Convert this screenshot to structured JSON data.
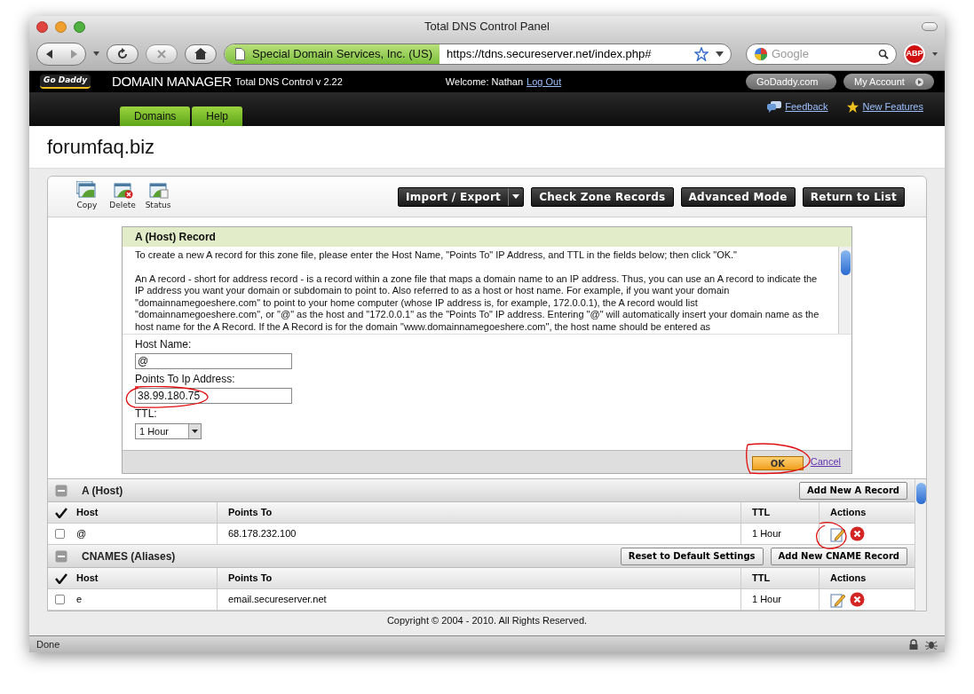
{
  "window": {
    "title": "Total DNS Control Panel"
  },
  "toolbar": {
    "site_identity": "Special Domain Services, Inc. (US)",
    "url": "https://tdns.secureserver.net/index.php#",
    "search_placeholder": "Google",
    "adblock_label": "ABP"
  },
  "header": {
    "logo_text": "Go Daddy",
    "app_name": "DOMAIN MANAGER",
    "version": "Total DNS Control v 2.22",
    "welcome": "Welcome: Nathan",
    "logout": "Log Out",
    "buttons": [
      "GoDaddy.com",
      "My Account"
    ]
  },
  "nav": {
    "tabs": [
      {
        "label": "Domains"
      },
      {
        "label": "Help"
      }
    ],
    "links": [
      {
        "label": "Feedback",
        "kind": "feedback"
      },
      {
        "label": "New Features",
        "kind": "star"
      }
    ]
  },
  "domain": "forumfaq.biz",
  "tools": [
    {
      "label": "Copy",
      "kind": "copy"
    },
    {
      "label": "Delete",
      "kind": "delete"
    },
    {
      "label": "Status",
      "kind": "status"
    }
  ],
  "actions": [
    {
      "label": "Import / Export",
      "kind": "dropdown"
    },
    {
      "label": "Check Zone Records",
      "kind": "plain"
    },
    {
      "label": "Advanced Mode",
      "kind": "plain"
    },
    {
      "label": "Return to List",
      "kind": "plain"
    }
  ],
  "dialog": {
    "title": "A (Host) Record",
    "paragraphs": [
      "To create a new A record for this zone file, please enter the Host Name, \"Points To\" IP Address, and TTL in the fields below; then click \"OK.\"",
      "An A record - short for address record - is a record within a zone file that maps a domain name to an IP address. Thus, you can use an A record to indicate the IP address you want your domain or subdomain to point to. Also referred to as a host or host name. For example, if you want your domain \"domainnamegoeshere.com\" to point to your home computer (whose IP address is, for example, 172.0.0.1), the A record would list \"domainnamegoeshere.com\", or \"@\" as the host and \"172.0.0.1\" as the \"Points To\" IP address. Entering \"@\" will automatically insert your domain name as the host name for the A Record. If the A Record is for the domain \"www.domainnamegoeshere.com\", the host name should be entered as"
    ],
    "host_label": "Host Name:",
    "host_value": "@",
    "ip_label": "Points To Ip Address:",
    "ip_value": "38.99.180.75",
    "ttl_label": "TTL:",
    "ttl_value": "1 Hour",
    "ok": "OK",
    "cancel": "Cancel"
  },
  "sections": [
    {
      "title": "A (Host)",
      "expanded": true,
      "buttons": [
        "Add New A Record"
      ],
      "columns": [
        "Host",
        "Points To",
        "TTL",
        "Actions"
      ],
      "rows": [
        {
          "checked": false,
          "host": "@",
          "points_to": "68.178.232.100",
          "ttl": "1 Hour"
        }
      ]
    },
    {
      "title": "CNAMES (Aliases)",
      "expanded": true,
      "buttons": [
        "Reset to Default Settings",
        "Add New CNAME Record"
      ],
      "columns": [
        "Host",
        "Points To",
        "TTL",
        "Actions"
      ],
      "rows": [
        {
          "checked": false,
          "host": "e",
          "points_to": "email.secureserver.net",
          "ttl": "1 Hour"
        }
      ]
    }
  ],
  "footer": "Copyright © 2004 - 2010. All Rights Reserved.",
  "status_bar": "Done"
}
